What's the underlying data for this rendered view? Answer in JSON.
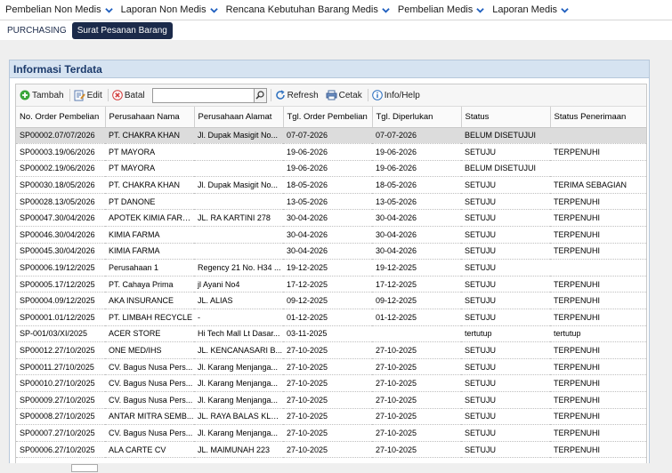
{
  "nav": {
    "items": [
      {
        "label": "Pembelian Non Medis"
      },
      {
        "label": "Laporan Non Medis"
      },
      {
        "label": "Rencana Kebutuhan Barang Medis"
      },
      {
        "label": "Pembelian Medis"
      },
      {
        "label": "Laporan Medis"
      }
    ]
  },
  "breadcrumb": {
    "parent": "PURCHASING",
    "current": "Surat Pesanan Barang"
  },
  "panel": {
    "title": "Informasi Terdata"
  },
  "toolbar": {
    "add_label": "Tambah",
    "edit_label": "Edit",
    "cancel_label": "Batal",
    "search_value": "",
    "refresh_label": "Refresh",
    "print_label": "Cetak",
    "help_label": "Info/Help"
  },
  "colors": {
    "accent": "#1b2a4a",
    "nav_chevron": "#1f5fbf",
    "panel_header": "#d6e3f1"
  },
  "table": {
    "columns": [
      "No. Order Pembelian",
      "Perusahaan Nama",
      "Perusahaan Alamat",
      "Tgl. Order Pembelian",
      "Tgl. Diperlukan",
      "Status",
      "Status Penerimaan"
    ],
    "rows": [
      [
        "SP00002.07/07/2026",
        "PT. CHAKRA KHAN",
        "Jl. Dupak Masigit No...",
        "07-07-2026",
        "07-07-2026",
        "BELUM DISETUJUI",
        ""
      ],
      [
        "SP00003.19/06/2026",
        "PT MAYORA",
        "",
        "19-06-2026",
        "19-06-2026",
        "SETUJU",
        "TERPENUHI"
      ],
      [
        "SP00002.19/06/2026",
        "PT MAYORA",
        "",
        "19-06-2026",
        "19-06-2026",
        "BELUM DISETUJUI",
        ""
      ],
      [
        "SP00030.18/05/2026",
        "PT. CHAKRA KHAN",
        "Jl. Dupak Masigit No...",
        "18-05-2026",
        "18-05-2026",
        "SETUJU",
        "TERIMA SEBAGIAN"
      ],
      [
        "SP00028.13/05/2026",
        "PT DANONE",
        "",
        "13-05-2026",
        "13-05-2026",
        "SETUJU",
        "TERPENUHI"
      ],
      [
        "SP00047.30/04/2026",
        "APOTEK KIMIA FARMA",
        "JL. RA KARTINI 278",
        "30-04-2026",
        "30-04-2026",
        "SETUJU",
        "TERPENUHI"
      ],
      [
        "SP00046.30/04/2026",
        "KIMIA FARMA",
        "",
        "30-04-2026",
        "30-04-2026",
        "SETUJU",
        "TERPENUHI"
      ],
      [
        "SP00045.30/04/2026",
        "KIMIA FARMA",
        "",
        "30-04-2026",
        "30-04-2026",
        "SETUJU",
        "TERPENUHI"
      ],
      [
        "SP00006.19/12/2025",
        "Perusahaan 1",
        "Regency 21 No. H34 ...",
        "19-12-2025",
        "19-12-2025",
        "SETUJU",
        ""
      ],
      [
        "SP00005.17/12/2025",
        "PT. Cahaya Prima",
        "jl Ayani No4",
        "17-12-2025",
        "17-12-2025",
        "SETUJU",
        "TERPENUHI"
      ],
      [
        "SP00004.09/12/2025",
        "AKA INSURANCE",
        "JL. ALIAS",
        "09-12-2025",
        "09-12-2025",
        "SETUJU",
        "TERPENUHI"
      ],
      [
        "SP00001.01/12/2025",
        "PT. LIMBAH RECYCLE",
        "-",
        "01-12-2025",
        "01-12-2025",
        "SETUJU",
        "TERPENUHI"
      ],
      [
        "SP-001/03/XI/2025",
        "ACER STORE",
        "Hi Tech Mall Lt Dasar...",
        "03-11-2025",
        "",
        "tertutup",
        "tertutup"
      ],
      [
        "SP00012.27/10/2025",
        "ONE MED/IHS",
        "JL. KENCANASARI B...",
        "27-10-2025",
        "27-10-2025",
        "SETUJU",
        "TERPENUHI"
      ],
      [
        "SP00011.27/10/2025",
        "CV. Bagus Nusa Pers...",
        "Jl. Karang Menjanga...",
        "27-10-2025",
        "27-10-2025",
        "SETUJU",
        "TERPENUHI"
      ],
      [
        "SP00010.27/10/2025",
        "CV. Bagus Nusa Pers...",
        "Jl. Karang Menjanga...",
        "27-10-2025",
        "27-10-2025",
        "SETUJU",
        "TERPENUHI"
      ],
      [
        "SP00009.27/10/2025",
        "CV. Bagus Nusa Pers...",
        "Jl. Karang Menjanga...",
        "27-10-2025",
        "27-10-2025",
        "SETUJU",
        "TERPENUHI"
      ],
      [
        "SP00008.27/10/2025",
        "ANTAR MITRA SEMB...",
        "JL. RAYA BALAS KLU...",
        "27-10-2025",
        "27-10-2025",
        "SETUJU",
        "TERPENUHI"
      ],
      [
        "SP00007.27/10/2025",
        "CV. Bagus Nusa Pers...",
        "Jl. Karang Menjanga...",
        "27-10-2025",
        "27-10-2025",
        "SETUJU",
        "TERPENUHI"
      ],
      [
        "SP00006.27/10/2025",
        "ALA CARTE CV",
        "JL. MAIMUNAH 223",
        "27-10-2025",
        "27-10-2025",
        "SETUJU",
        "TERPENUHI"
      ]
    ],
    "selected_row": 0
  }
}
